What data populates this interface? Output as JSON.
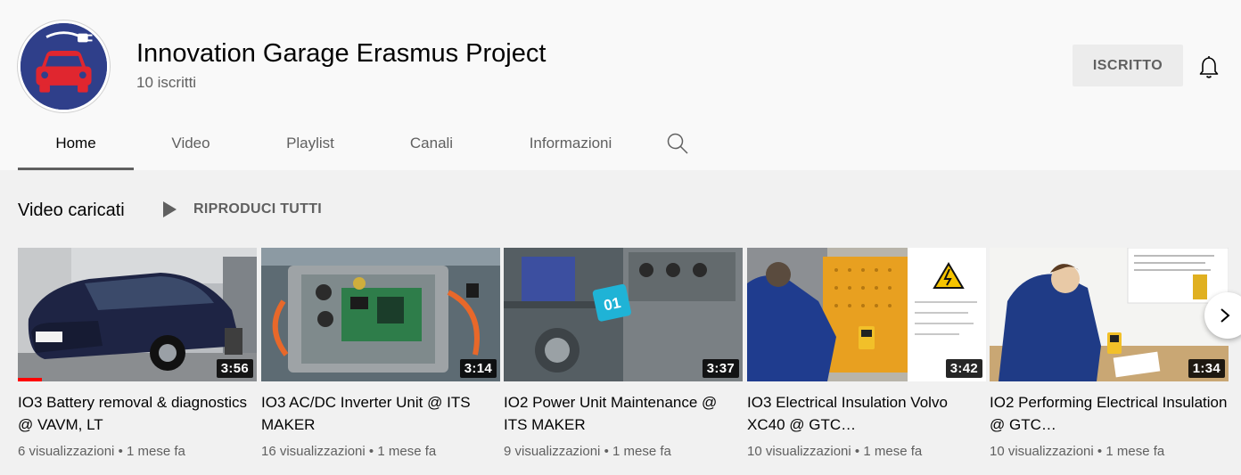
{
  "channel": {
    "title": "Innovation Garage Erasmus Project",
    "subscribers": "10 iscritti",
    "subscribe_label": "ISCRITTO",
    "avatar_icon": "car-plug-logo-icon",
    "avatar_bg": "#2f3f8a",
    "avatar_car_color": "#e0262f"
  },
  "tabs": [
    {
      "label": "Home",
      "active": true
    },
    {
      "label": "Video",
      "active": false
    },
    {
      "label": "Playlist",
      "active": false
    },
    {
      "label": "Canali",
      "active": false
    },
    {
      "label": "Informazioni",
      "active": false
    }
  ],
  "shelf": {
    "title": "Video caricati",
    "play_all_label": "RIPRODUCI TUTTI"
  },
  "videos": [
    {
      "title": "IO3 Battery removal & diagnostics @ VAVM, LT",
      "duration": "3:56",
      "views": "6 visualizzazioni",
      "age": "1 mese fa",
      "watched_fraction": 0.1
    },
    {
      "title": "IO3 AC/DC Inverter Unit @ ITS MAKER",
      "duration": "3:14",
      "views": "16 visualizzazioni",
      "age": "1 mese fa"
    },
    {
      "title": "IO2 Power Unit Maintenance @ ITS MAKER",
      "duration": "3:37",
      "views": "9 visualizzazioni",
      "age": "1 mese fa"
    },
    {
      "title": "IO3 Electrical Insulation Volvo XC40 @ GTC…",
      "duration": "3:42",
      "views": "10 visualizzazioni",
      "age": "1 mese fa"
    },
    {
      "title": "IO2 Performing Electrical Insulation @ GTC…",
      "duration": "1:34",
      "views": "10 visualizzazioni",
      "age": "1 mese fa"
    }
  ],
  "meta_separator": "•",
  "thumb2_badge": "01",
  "icons": {
    "bell": "bell-icon",
    "search": "search-icon",
    "play": "play-icon",
    "next": "chevron-right-icon"
  }
}
